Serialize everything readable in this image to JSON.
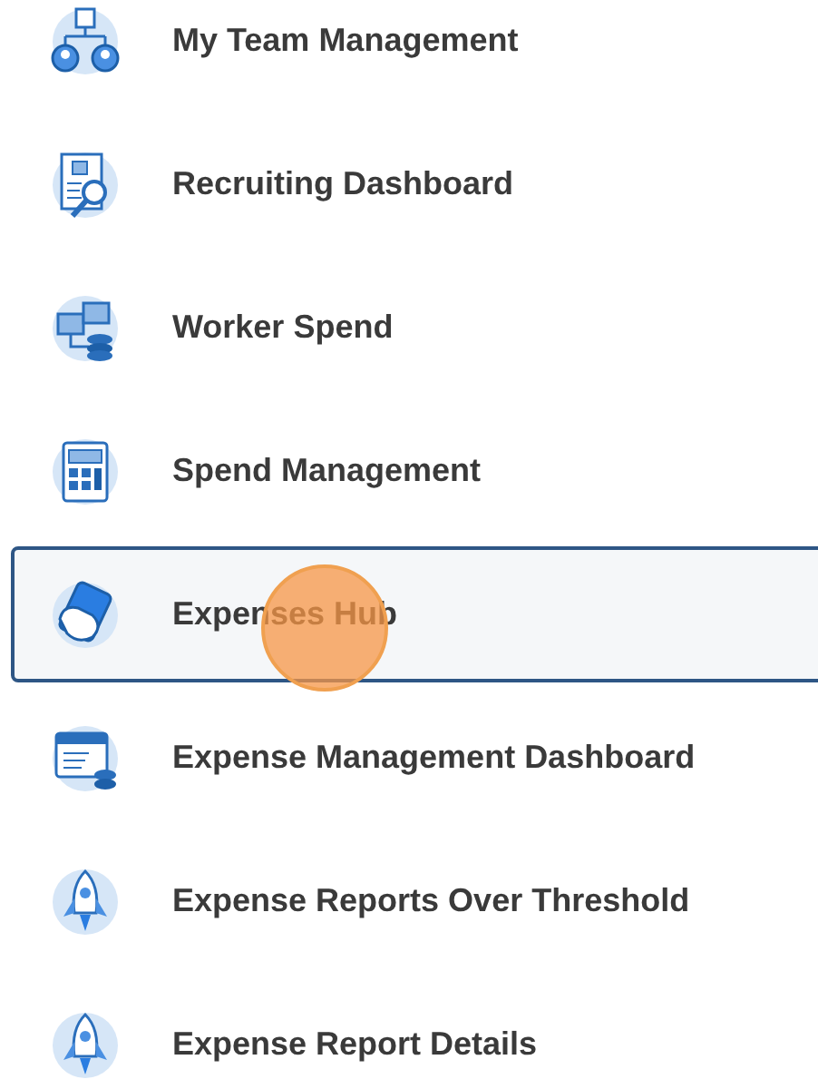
{
  "menu_items": [
    {
      "label": "My Team Management",
      "kind": "team",
      "selected": false
    },
    {
      "label": "Recruiting Dashboard",
      "kind": "recruiting",
      "selected": false
    },
    {
      "label": "Worker Spend",
      "kind": "worker_spend",
      "selected": false
    },
    {
      "label": "Spend Management",
      "kind": "calculator",
      "selected": false
    },
    {
      "label": "Expenses Hub",
      "kind": "hand_money",
      "selected": true
    },
    {
      "label": "Expense Management Dashboard",
      "kind": "dashboard",
      "selected": false
    },
    {
      "label": "Expense Reports Over Threshold",
      "kind": "rocket",
      "selected": false
    },
    {
      "label": "Expense Report Details",
      "kind": "rocket",
      "selected": false
    }
  ]
}
